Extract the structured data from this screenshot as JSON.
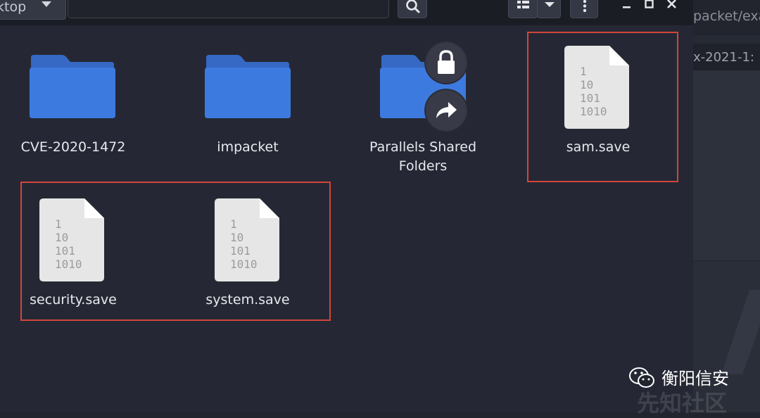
{
  "toolbar": {
    "location_label": "ktop",
    "icons": [
      "chevron-down-icon",
      "search-icon",
      "list-view-icon",
      "chevron-down-icon",
      "kebab-menu-icon",
      "minimize-icon",
      "maximize-icon",
      "close-icon"
    ]
  },
  "items": [
    {
      "name": "CVE-2020-1472",
      "type": "folder"
    },
    {
      "name": "impacket",
      "type": "folder"
    },
    {
      "name": "Parallels Shared\nFolders",
      "type": "folder",
      "emblems": [
        "lock-icon",
        "symlink-arrow-icon"
      ]
    },
    {
      "name": "sam.save",
      "type": "file",
      "highlighted": true
    },
    {
      "name": "security.save",
      "type": "file",
      "highlighted": true
    },
    {
      "name": "system.save",
      "type": "file",
      "highlighted": true
    }
  ],
  "file_icon_glyph": [
    "1",
    "10",
    "101",
    "1010"
  ],
  "background_window": {
    "path_fragment": "packet/exa",
    "tab_fragment": "x-2021-1:"
  },
  "watermark": {
    "text": "衡阳信安",
    "ghost_text": "先知社区"
  },
  "colors": {
    "folder": "#3d7ae0",
    "folder_tab": "#3569c4",
    "highlight_box": "#d2453b",
    "window_bg": "#252834",
    "toolbar_bg": "#1b1d24"
  }
}
